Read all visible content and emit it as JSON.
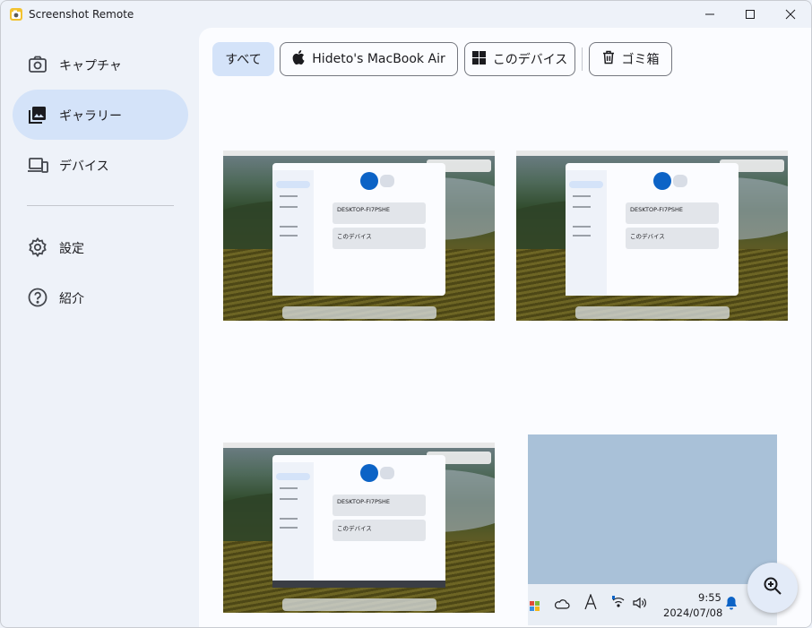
{
  "window": {
    "title": "Screenshot Remote"
  },
  "sidebar": {
    "items": [
      {
        "label": "キャプチャ",
        "icon": "camera-icon",
        "active": false
      },
      {
        "label": "ギャラリー",
        "icon": "gallery-icon",
        "active": true
      },
      {
        "label": "デバイス",
        "icon": "devices-icon",
        "active": false
      },
      {
        "label": "設定",
        "icon": "gear-icon",
        "active": false
      },
      {
        "label": "紹介",
        "icon": "help-icon",
        "active": false
      }
    ]
  },
  "filters": [
    {
      "label": "すべて",
      "icon": null,
      "selected": true
    },
    {
      "label": "Hideto's MacBook Air",
      "icon": "apple-icon",
      "selected": false
    },
    {
      "label": "このデバイス",
      "icon": "windows-icon",
      "selected": false
    },
    {
      "label": "ゴミ箱",
      "icon": "trash-icon",
      "selected": false
    }
  ],
  "gallery": {
    "mac_thumbs": [
      {
        "card1": "DESKTOP-FI7PSHE",
        "card2": "このデバイス"
      },
      {
        "card1": "DESKTOP-FI7PSHE",
        "card2": "このデバイス"
      },
      {
        "card1": "DESKTOP-FI7PSHE",
        "card2": "このデバイス"
      }
    ],
    "win_thumb": {
      "time": "9:55",
      "date": "2024/07/08"
    }
  },
  "fab": {
    "icon": "zoom-in-icon"
  },
  "colors": {
    "accent": "#0c63c6",
    "selected_bg": "#d4e3f9",
    "sidebar_bg": "#eef2f9",
    "content_bg": "#fbfcff"
  }
}
